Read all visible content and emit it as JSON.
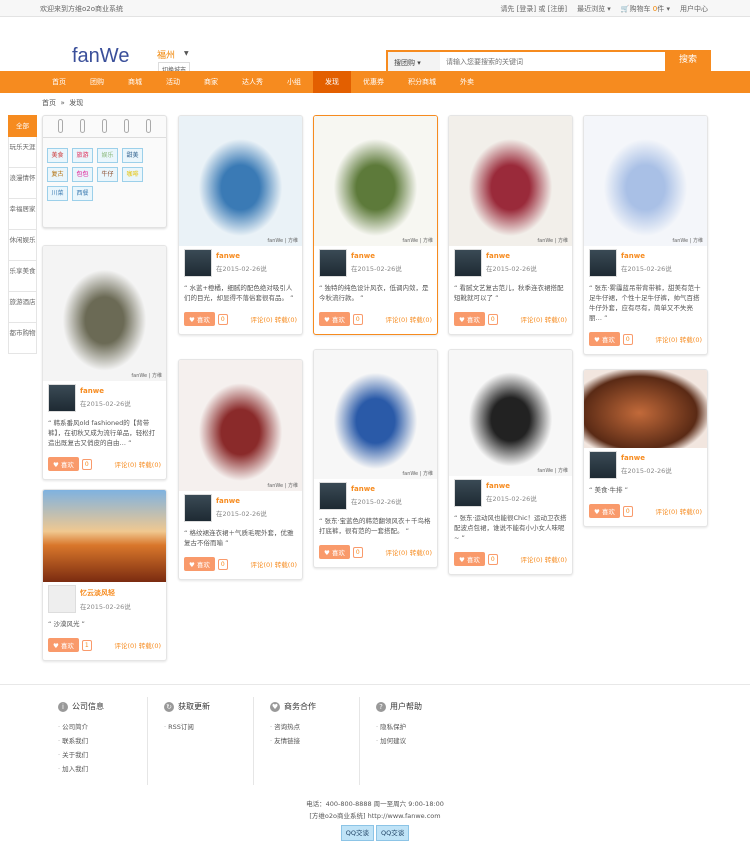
{
  "topbar": {
    "welcome": "欢迎来到方维o2o商业系统",
    "login_prefix": "请先",
    "login": "[登录]",
    "or": "或",
    "register": "[注册]",
    "recent": "最近浏览 ▾",
    "cart": "购物车",
    "cart_count": "0",
    "cart_unit": "件 ▾",
    "user_center": "用户中心"
  },
  "header": {
    "logo": "fanWe",
    "city": "福州",
    "switch_city": "切换城市",
    "search_type": "搜团购",
    "search_placeholder": "请输入您要搜索的关键词",
    "search_button": "搜索"
  },
  "nav": [
    "首页",
    "团购",
    "商城",
    "活动",
    "商家",
    "达人秀",
    "小组",
    "发现",
    "优惠券",
    "积分商城",
    "外卖"
  ],
  "nav_active": 7,
  "breadcrumb": {
    "home": "首页",
    "sep": "»",
    "current": "发现"
  },
  "sidebar": [
    "全部",
    "玩乐天涯",
    "浪漫情怀",
    "幸福居家",
    "休闲娱乐",
    "乐享美食",
    "旅游酒店",
    "都市购物"
  ],
  "tags": [
    "美食",
    "旅游",
    "娱乐",
    "甜美",
    "复古",
    "包包",
    "牛仔",
    "咖啡",
    "川菜",
    "西餐"
  ],
  "tag_colors": [
    "#c33",
    "#e0204f",
    "#8ab87a",
    "#2a5c8a",
    "#b06a00",
    "#e0008a",
    "#8a4a2a",
    "#e6c200",
    "#3a7ab0",
    "#3a7ab0"
  ],
  "cards": [
    {
      "user": "fanwe",
      "time": "在2015-02-26说",
      "text": "韩系番风old fashioned的【背带裤】，在初秋又成为流行单品，轻松打造出既复古又俏皮的自由…",
      "likes": "0",
      "comments": "评论(0) 转载(0)",
      "like_label": "喜欢",
      "colors": [
        "#f4f4f4",
        "#6b6a55"
      ]
    },
    {
      "user": "忆云淡风轻",
      "time": "在2015-02-26说",
      "text": "沙漠风光",
      "likes": "1",
      "comments": "评论(0) 转载(0)",
      "like_label": "喜欢",
      "colors": [
        "#d9772b",
        "#7a2b10"
      ]
    },
    {
      "user": "fanwe",
      "time": "在2015-02-26说",
      "text": "水蓝+橙橘，细腻的配色绝对吸引人们的目光，却显得不落俗套很有品。",
      "likes": "0",
      "comments": "评论(0) 转载(0)",
      "like_label": "喜欢",
      "colors": [
        "#eaf2f7",
        "#3a7ab5"
      ]
    },
    {
      "user": "fanwe",
      "time": "在2015-02-26说",
      "text": "格纹裙连衣裙＋气质毛呢外套，优雅复古不俗而喻",
      "likes": "0",
      "comments": "评论(0) 转载(0)",
      "like_label": "喜欢",
      "colors": [
        "#f5f0ee",
        "#8a2a2a"
      ]
    },
    {
      "user": "fanwe",
      "time": "在2015-02-26说",
      "text": "独特的纯色设计风衣，低调内敛，是今秋流行款。",
      "likes": "0",
      "comments": "评论(0) 转载(0)",
      "like_label": "喜欢",
      "colors": [
        "#f7f7f2",
        "#5d7a3a"
      ]
    },
    {
      "user": "fanwe",
      "time": "在2015-02-26说",
      "text": "张东·宝蓝色的韩范翻领风衣＋千鸟格打底裤，很有范的一套搭配。",
      "likes": "0",
      "comments": "评论(0) 转载(0)",
      "like_label": "喜欢",
      "colors": [
        "#f7f7f7",
        "#2a5aa8"
      ]
    },
    {
      "user": "fanwe",
      "time": "在2015-02-26说",
      "text": "看腻文艺复古范儿，秋季连衣裙搭配短靴就可以了",
      "likes": "0",
      "comments": "评论(0) 转载(0)",
      "like_label": "喜欢",
      "colors": [
        "#f2efea",
        "#9a2a3a"
      ]
    },
    {
      "user": "fanwe",
      "time": "在2015-02-26说",
      "text": "张东·运动风也能很Chic！运动卫衣搭配波点包裙，谁说不能有小小女人味呢~",
      "likes": "0",
      "comments": "评论(0) 转载(0)",
      "like_label": "喜欢",
      "colors": [
        "#f7f7f7",
        "#222"
      ]
    },
    {
      "user": "fanwe",
      "time": "在2015-02-26说",
      "text": "张东·雾霾蓝吊带背带裤，甜美有范十足牛仔裙，个性十足牛仔裤，帅气百搭牛仔外套，应有尽有，简单又不失亮丽…",
      "likes": "0",
      "comments": "评论(0) 转载(0)",
      "like_label": "喜欢",
      "colors": [
        "#f4f6fa",
        "#a9c0e6"
      ]
    },
    {
      "user": "fanwe",
      "time": "在2015-02-26说",
      "text": "美食·牛排",
      "likes": "0",
      "comments": "评论(0) 转载(0)",
      "like_label": "喜欢",
      "colors": [
        "#c26a3a",
        "#5a2a15"
      ]
    }
  ],
  "watermark": "fanWe | 方维",
  "footer": {
    "cols": [
      {
        "title": "公司信息",
        "icon": "i",
        "links": [
          "公司简介",
          "联系我们",
          "关于我们",
          "加入我们"
        ]
      },
      {
        "title": "获取更新",
        "icon": "↻",
        "links": [
          "RSS订阅"
        ]
      },
      {
        "title": "商务合作",
        "icon": "♥",
        "links": [
          "咨询热点",
          "友情链接"
        ]
      },
      {
        "title": "用户帮助",
        "icon": "?",
        "links": [
          "隐私保护",
          "加何建议"
        ]
      }
    ],
    "phone": "电话：400-800-8888 周一至周六 9:00-18:00",
    "site": "[方维o2o商业系统] http://www.fanwe.com",
    "qq": [
      "QQ交谈",
      "QQ交谈"
    ]
  }
}
